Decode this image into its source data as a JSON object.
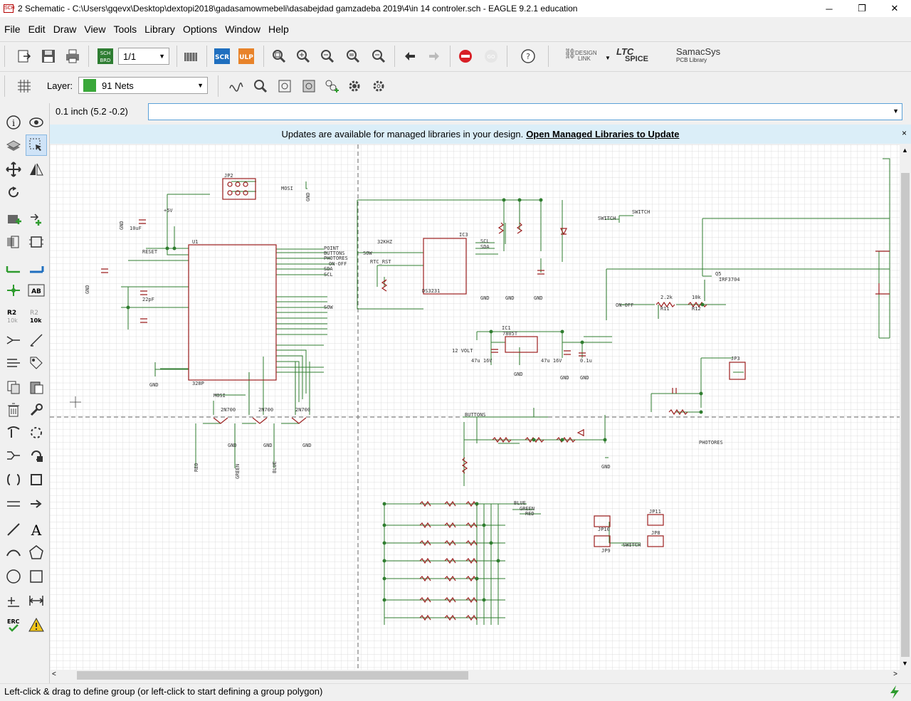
{
  "window": {
    "title": "2 Schematic - C:\\Users\\gqevx\\Desktop\\dextopi2018\\gadasamowmebeli\\dasabejdad gamzadeba 2019\\4\\in 14 controler.sch - EAGLE 9.2.1 education",
    "app_icon": "SCH",
    "minimize": "─",
    "maximize": "❐",
    "close": "✕"
  },
  "menu": [
    "File",
    "Edit",
    "Draw",
    "View",
    "Tools",
    "Library",
    "Options",
    "Window",
    "Help"
  ],
  "toolbar": {
    "sheet_select": "1/1",
    "scr_label": "SCR",
    "ulp_label": "ULP",
    "sch_brd_top": "SCH",
    "sch_brd_bottom": "BRD",
    "design_link_top": "DESIGN",
    "design_link_bottom": "LINK",
    "ltc_top": "LTC",
    "ltc_bottom": "SPICE",
    "samacsys_top": "SamacSys",
    "samacsys_bottom": "PCB Library",
    "help": "?"
  },
  "layer": {
    "label": "Layer:",
    "value": "91 Nets",
    "color": "#3aa83a"
  },
  "coord_readout": "0.1 inch (5.2 -0.2)",
  "command_input": "",
  "notification": {
    "text": "Updates are available for managed libraries in your design.",
    "link": "Open Managed Libraries to Update",
    "close": "×"
  },
  "left_tools": {
    "value_r2_top": "R2",
    "value_r2_bottom": "10k",
    "value_r2b_top": "R2",
    "value_r2b_bottom": "10k",
    "ab_label": "AB",
    "text_label": "A",
    "erc_label": "ERC"
  },
  "schematic_labels": {
    "jp2": "JP2",
    "mosi": "MOSI",
    "gnd": "GND",
    "ic1_top": "U1",
    "u1_part": "328P",
    "ic3": "IC3",
    "ds3231": "DS3231",
    "ic1": "IC1",
    "reg": "7805T",
    "point": "POINT",
    "buttons": "BUTTONS",
    "photores": "PHOTORES",
    "onoff": "ON-OFF",
    "sda": "SDA",
    "scl": "SCL",
    "sow": "SOW",
    "khz": "32KHZ",
    "rtc_rst": "RTC_RST",
    "switch": "SWITCH",
    "q5": "Q5",
    "irf": "IRF3704",
    "r11": "R11",
    "r12": "R12",
    "r11v": "2.2k",
    "r12v": "10k",
    "jp3": "JP3",
    "photores2": "PHOTORES",
    "buttons2": "BUTTONS",
    "red": "RED",
    "green": "GREEN",
    "blue": "BLUE",
    "q2": "2N700",
    "blue2": "BLUE",
    "green2": "GREEN",
    "red2": "RED",
    "jp10": "JP10",
    "jp9": "JP9",
    "jp11": "JP11",
    "jp8": "JP8",
    "switch2": "SWITCH",
    "reset": "RESET",
    "c1": "22pF",
    "cap": "10uF",
    "v12": "12 VOLT",
    "c47": "47u 16V",
    "c01": "0.1u",
    "plus5": "+5V"
  },
  "status": "Left-click & drag to define group (or left-click to start defining a group polygon)"
}
